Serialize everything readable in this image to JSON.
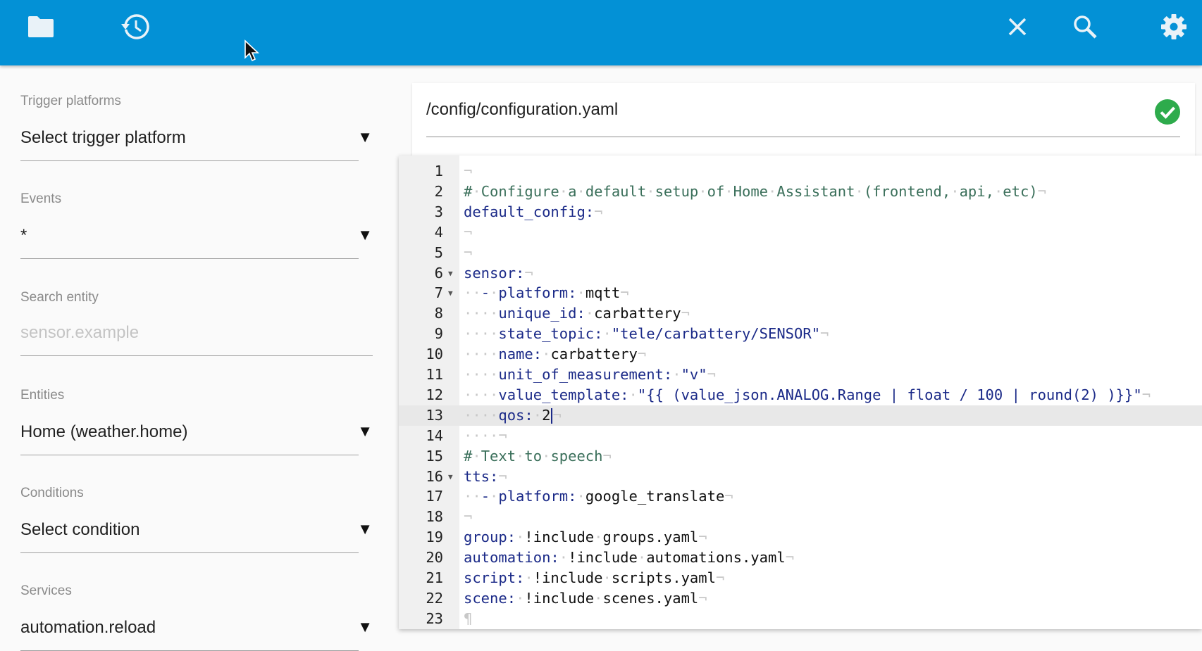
{
  "toolbar": {
    "icons": [
      "folder-icon",
      "history-icon",
      "close-icon",
      "search-icon",
      "gear-icon"
    ],
    "color": "#0391d6"
  },
  "left_panel": {
    "trigger_platforms": {
      "label": "Trigger platforms",
      "value": "Select trigger platform"
    },
    "events": {
      "label": "Events",
      "value": "*"
    },
    "search_entity": {
      "label": "Search entity",
      "placeholder": "sensor.example"
    },
    "entities": {
      "label": "Entities",
      "value": "Home (weather.home)"
    },
    "conditions": {
      "label": "Conditions",
      "value": "Select condition"
    },
    "services": {
      "label": "Services",
      "value": "automation.reload"
    }
  },
  "file": {
    "path": "/config/configuration.yaml",
    "status_icon": "check-circle-icon",
    "status_color": "#2eab4c"
  },
  "editor": {
    "active_line": 13,
    "lines": [
      {
        "n": "1",
        "text": ""
      },
      {
        "n": "2",
        "text": "# Configure a default setup of Home Assistant (frontend, api, etc)"
      },
      {
        "n": "3",
        "text": "default_config:"
      },
      {
        "n": "4",
        "text": ""
      },
      {
        "n": "5",
        "text": ""
      },
      {
        "n": "6",
        "text": "sensor:",
        "fold": true
      },
      {
        "n": "7",
        "text": "  - platform: mqtt",
        "fold": true
      },
      {
        "n": "8",
        "text": "    unique_id: carbattery"
      },
      {
        "n": "9",
        "text": "    state_topic: \"tele/carbattery/SENSOR\""
      },
      {
        "n": "10",
        "text": "    name: carbattery"
      },
      {
        "n": "11",
        "text": "    unit_of_measurement: \"v\""
      },
      {
        "n": "12",
        "text": "    value_template: \"{{ (value_json.ANALOG.Range | float / 100 | round(2) )}}\""
      },
      {
        "n": "13",
        "text": "    qos: 2"
      },
      {
        "n": "14",
        "text": "    "
      },
      {
        "n": "15",
        "text": "# Text to speech"
      },
      {
        "n": "16",
        "text": "tts:",
        "fold": true
      },
      {
        "n": "17",
        "text": "  - platform: google_translate"
      },
      {
        "n": "18",
        "text": ""
      },
      {
        "n": "19",
        "text": "group: !include groups.yaml"
      },
      {
        "n": "20",
        "text": "automation: !include automations.yaml"
      },
      {
        "n": "21",
        "text": "script: !include scripts.yaml"
      },
      {
        "n": "22",
        "text": "scene: !include scenes.yaml"
      },
      {
        "n": "23",
        "text": ""
      }
    ]
  }
}
